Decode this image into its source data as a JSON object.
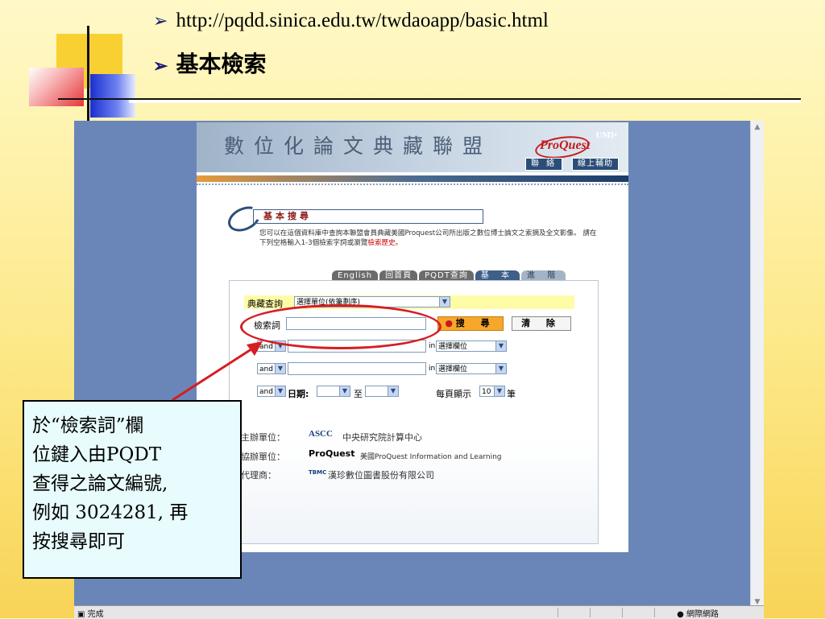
{
  "slide": {
    "url_bullet": "http://pqdd.sinica.edu.tw/twdaoapp/basic.html",
    "heading_bullet": "基本檢索",
    "bullet_symbol": "➢"
  },
  "site": {
    "banner_title": "數位化論文典藏聯盟",
    "logo_umi": "UMI•",
    "logo_name": "ProQuest",
    "nav_contact": "聯 絡",
    "nav_help": "線上輔助",
    "section_title": "基本搜尋",
    "intro_text_1": "您可以在這個資料庫中查詢本聯盟會員典藏美國Proquest公司所出版之數位博士論文之索摘及全文影像。 請在下列空格輸入1-3個檢索字詞或瀏覽",
    "intro_link": "檢索歷史",
    "intro_end": "。",
    "tabs": [
      "English",
      "回首頁",
      "PQDT查詢",
      "基 本",
      "進 階"
    ]
  },
  "form": {
    "collection_label": "典藏查詢",
    "collection_select": "選擇單位(依筆劃序)",
    "keyword_label": "檢索詞",
    "keyword_value": "",
    "search_button": "搜 尋",
    "clear_button": "清 除",
    "op_and_1": "and",
    "op_and_2": "and",
    "op_and_3": "and",
    "in_label_1": "in",
    "in_label_2": "in",
    "field_select_1": "選擇欄位",
    "field_select_2": "選擇欄位",
    "date_label": "日期:",
    "date_to": "至",
    "per_page_label": "每頁顯示",
    "per_page_value": "10",
    "per_page_unit": "筆"
  },
  "sponsors": {
    "host_label": "主辦單位：",
    "host_logo": "ASCC",
    "host_name": "中央研究院計算中心",
    "co_label": "協辦單位：",
    "co_logo": "ProQuest",
    "co_name": "美國ProQuest Information and Learning",
    "agent_label": "代理商：",
    "agent_logo": "TBMC",
    "agent_name": "漢珍數位圖書股份有限公司"
  },
  "browser": {
    "status_text": "完成",
    "zone_text": "網際網路"
  },
  "callout": {
    "line1": "於“檢索詞”欄",
    "line2": "位鍵入由PQDT",
    "line3": "查得之論文編號,",
    "line4": "例如 3024281, 再",
    "line5": "按搜尋即可"
  },
  "colors": {
    "annotation_red": "#d61d24",
    "callout_bg": "#e8fbfd",
    "site_navy": "#2b4d78"
  }
}
